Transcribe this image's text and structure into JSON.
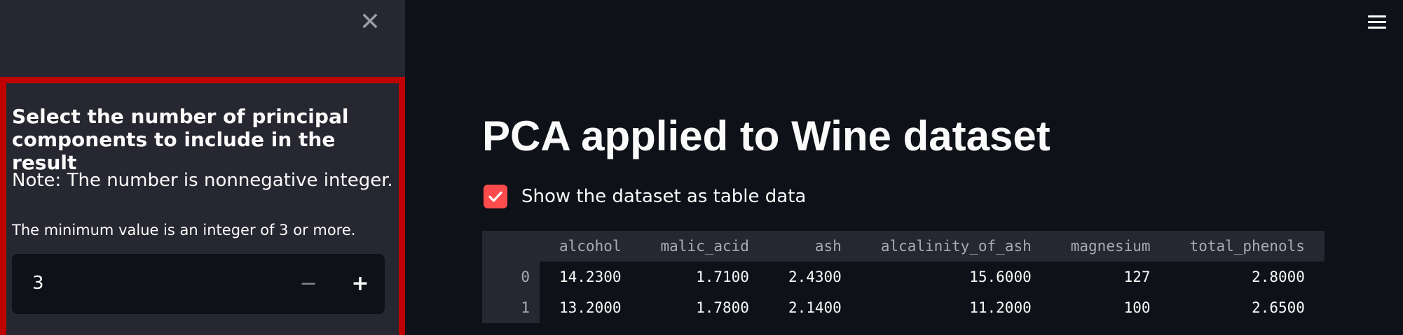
{
  "sidebar": {
    "close_symbol": "✕",
    "title": "Select the number of principal components to include in the result",
    "note": "Note: The number is nonnegative integer.",
    "min_text": "The minimum value is an integer of 3 or more.",
    "number_input": {
      "value": "3",
      "minus_symbol": "−",
      "plus_symbol": "+"
    },
    "highlight_color": "#c00000"
  },
  "main": {
    "title": "PCA applied to Wine dataset",
    "checkbox": {
      "label": "Show the dataset as table data",
      "checked": true,
      "color": "#ff4b4b"
    },
    "table": {
      "columns": [
        "alcohol",
        "malic_acid",
        "ash",
        "alcalinity_of_ash",
        "magnesium",
        "total_phenols"
      ],
      "rows": [
        {
          "index": "0",
          "cells": [
            "14.2300",
            "1.7100",
            "2.4300",
            "15.6000",
            "127",
            "2.8000"
          ]
        },
        {
          "index": "1",
          "cells": [
            "13.2000",
            "1.7800",
            "2.1400",
            "11.2000",
            "100",
            "2.6500"
          ]
        }
      ]
    }
  },
  "icons": {
    "close": "close-icon",
    "menu": "hamburger-menu-icon",
    "check": "check-icon"
  }
}
